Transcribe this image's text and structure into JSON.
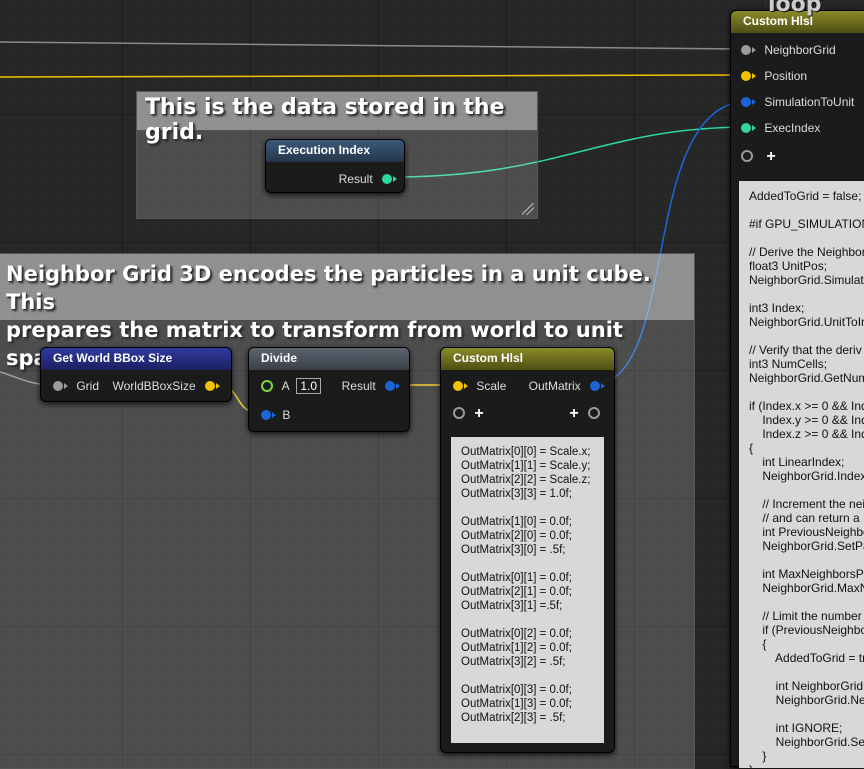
{
  "colors": {
    "float_pin": "#f2c200",
    "matrix_pin": "#1a66d9",
    "int_pin": "#2ed6a0",
    "struct_pin": "#9a9a9a",
    "annotation_underline": "#e3121a"
  },
  "partial_label": "loop",
  "comments": {
    "data_in_grid": "This is the data stored in the grid.",
    "unit_cube_line1": "Neighbor Grid 3D encodes the particles in a unit cube. This",
    "unit_cube_line2": "prepares the matrix to transform from world to unit space."
  },
  "nodes": {
    "execution_index": {
      "title": "Execution Index",
      "output": "Result"
    },
    "get_world_bbox": {
      "title": "Get World BBox Size",
      "input": "Grid",
      "output": "WorldBBoxSize"
    },
    "divide": {
      "title": "Divide",
      "input_a": "A",
      "input_a_value": "1.0",
      "input_b": "B",
      "output": "Result"
    },
    "custom_hlsl_matrix": {
      "title": "Custom Hlsl",
      "input": "Scale",
      "output": "OutMatrix",
      "code": "OutMatrix[0][0] = Scale.x;\nOutMatrix[1][1] = Scale.y;\nOutMatrix[2][2] = Scale.z;\nOutMatrix[3][3] = 1.0f;\n\nOutMatrix[1][0] = 0.0f;\nOutMatrix[2][0] = 0.0f;\nOutMatrix[3][0] = .5f;\n\nOutMatrix[0][1] = 0.0f;\nOutMatrix[2][1] = 0.0f;\nOutMatrix[3][1] =.5f;\n\nOutMatrix[0][2] = 0.0f;\nOutMatrix[1][2] = 0.0f;\nOutMatrix[3][2] = .5f;\n\nOutMatrix[0][3] = 0.0f;\nOutMatrix[1][3] = 0.0f;\nOutMatrix[2][3] = .5f;"
    },
    "custom_hlsl_grid": {
      "title": "Custom Hlsl",
      "inputs": [
        "NeighborGrid",
        "Position",
        "SimulationToUnit",
        "ExecIndex"
      ],
      "code": "AddedToGrid = false;\n\n#if GPU_SIMULATION\n\n// Derive the Neighbor\nfloat3 UnitPos;\nNeighborGrid.Simulat\n\nint3 Index;\nNeighborGrid.UnitToIn\n\n// Verify that the deriv\nint3 NumCells;\nNeighborGrid.GetNum\n\nif (Index.x >= 0 && Inde\n    Index.y >= 0 && Inde\n    Index.z >= 0 && Inde\n{\n    int LinearIndex;\n    NeighborGrid.Index\n\n    // Increment the nei\n    // and can return a\n    int PreviousNeighbo\n    NeighborGrid.SetPa\n\n    int MaxNeighborsPe\n    NeighborGrid.MaxN\n\n    // Limit the number\n    if (PreviousNeighbo\n    {\n        AddedToGrid = tr\n\n        int NeighborGridL\n        NeighborGrid.Nei\n\n        int IGNORE;\n        NeighborGrid.Set\n    }\n}"
    }
  }
}
